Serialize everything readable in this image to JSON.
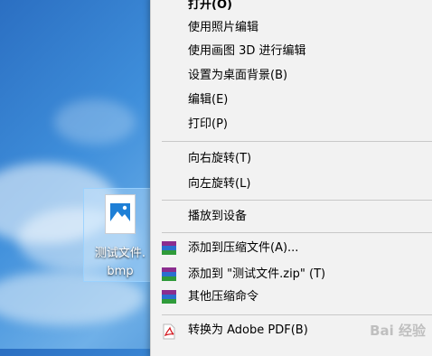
{
  "desktop": {
    "file_label_line1": "测试文件.",
    "file_label_line2": "bmp"
  },
  "menu": {
    "items": [
      {
        "label": "打开(O)"
      },
      {
        "label": "使用照片编辑"
      },
      {
        "label": "使用画图 3D 进行编辑"
      },
      {
        "label": "设置为桌面背景(B)"
      },
      {
        "label": "编辑(E)"
      },
      {
        "label": "打印(P)"
      },
      {
        "label": "向右旋转(T)"
      },
      {
        "label": "向左旋转(L)"
      },
      {
        "label": "播放到设备"
      },
      {
        "label": "添加到压缩文件(A)..."
      },
      {
        "label": "添加到 \"测试文件.zip\" (T)"
      },
      {
        "label": "其他压缩命令"
      },
      {
        "label": "转换为 Adobe PDF(B)"
      }
    ]
  },
  "watermark": "Bai 经验",
  "colors": {
    "menu_bg": "#f2f2f2",
    "selection_bg": "#cce8ff",
    "selection_border": "#99d1ff"
  },
  "icons": {
    "image_file": "picture-file-icon",
    "archive": "winrar-archive-icon",
    "pdf": "adobe-pdf-icon"
  }
}
